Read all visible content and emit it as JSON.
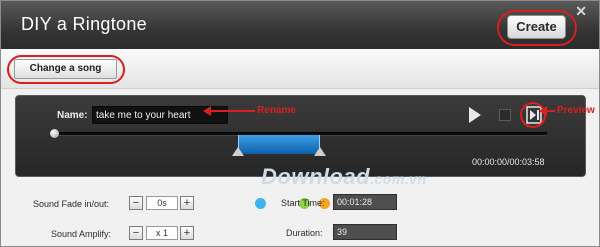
{
  "window": {
    "title": "DIY a Ringtone",
    "close_glyph": "✕"
  },
  "toolbar": {
    "create_label": "Create",
    "change_song_label": "Change a song"
  },
  "player": {
    "name_label": "Name:",
    "name_value": "take me to your heart",
    "time_readout": "00:00:00/00:03:58",
    "play_icon": "play-icon",
    "stop_icon": "stop-icon",
    "preview_icon": "preview-icon"
  },
  "annotations": {
    "rename": "Rename",
    "preview": "Preview",
    "color": "#d7201f"
  },
  "settings": {
    "fade_label": "Sound Fade in/out:",
    "fade_value": "0s",
    "amplify_label": "Sound Amplify:",
    "amplify_value": "x 1",
    "minus": "−",
    "plus": "+",
    "start_label": "Start Time:",
    "start_value": "00:01:28",
    "duration_label": "Duration:",
    "duration_value": "39"
  },
  "watermark": {
    "text": "Download",
    "tld": ".com.vn"
  },
  "colors": {
    "accent": "#1f7fcf",
    "title_bg": "#353535",
    "panel_bg": "#2c2c2c"
  }
}
